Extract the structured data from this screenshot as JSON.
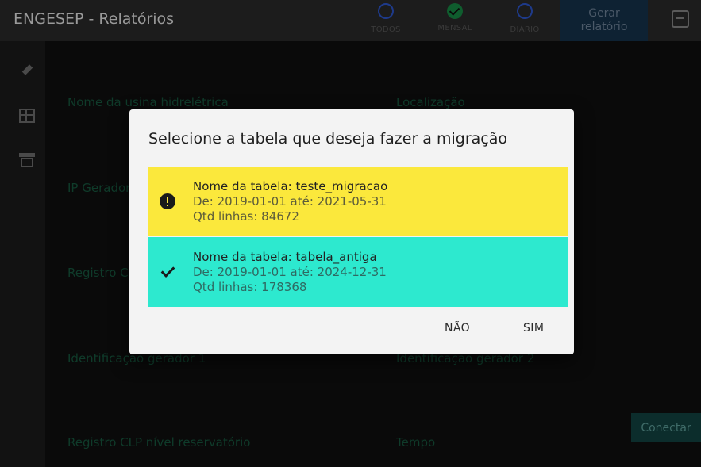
{
  "app": {
    "title": "ENGESEP - Relatórios"
  },
  "header": {
    "options": [
      {
        "label": "TODOS",
        "selected": false
      },
      {
        "label": "MENSAL",
        "selected": true
      },
      {
        "label": "DIÁRIO",
        "selected": false
      }
    ],
    "generate_button": "Gerar relatório",
    "exit_icon": "exit-icon"
  },
  "sidebar": {
    "icons": [
      "plug-icon",
      "table-icon",
      "archive-icon"
    ]
  },
  "form": {
    "labels": [
      "Nome da usina hidrelétrica",
      "Localização",
      "IP Gerador",
      "Registro C",
      "Identificação gerador 1",
      "Identificação gerador 2",
      "Registro CLP nível reservatório",
      "Tempo"
    ],
    "connect_button": "Conectar"
  },
  "dialog": {
    "title": "Selecione a tabela que deseja fazer a migração",
    "items": [
      {
        "icon": "alert-icon",
        "name": "Nome da tabela: teste_migracao",
        "range": "De: 2019-01-01  até: 2021-05-31",
        "rows": "Qtd linhas: 84672",
        "color": "#fbe83c"
      },
      {
        "icon": "check-icon",
        "name": "Nome da tabela: tabela_antiga",
        "range": "De: 2019-01-01  até: 2024-12-31",
        "rows": "Qtd linhas: 178368",
        "color": "#2de9cf"
      }
    ],
    "no_button": "NÃO",
    "yes_button": "SIM"
  }
}
